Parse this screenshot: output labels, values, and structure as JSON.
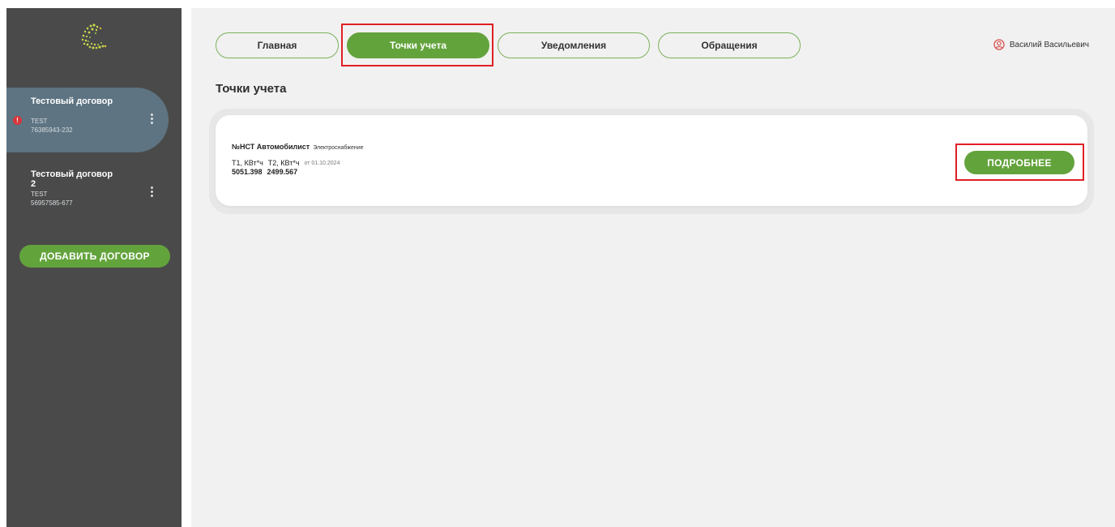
{
  "sidebar": {
    "contracts": [
      {
        "name": "Тестовый договор",
        "code": "TEST",
        "number": "76385943-232",
        "active": true,
        "has_alert": true
      },
      {
        "name": "Тестовый договор 2",
        "code": "TEST",
        "number": "56957585-677",
        "active": false,
        "has_alert": false
      }
    ],
    "add_label": "ДОБАВИТЬ ДОГОВОР",
    "alert_glyph": "!"
  },
  "nav": {
    "tabs": [
      {
        "label": "Главная",
        "active": false
      },
      {
        "label": "Точки учета",
        "active": true
      },
      {
        "label": "Уведомления",
        "active": false
      },
      {
        "label": "Обращения",
        "active": false
      }
    ]
  },
  "user": {
    "name": "Василий Васильевич",
    "icon": "user-circle-icon"
  },
  "page": {
    "title": "Точки учета"
  },
  "point": {
    "title": "№НСТ Автомобилист",
    "type": "Электроснабжение",
    "t1_label": "Т1, КВт*ч",
    "t2_label": "Т2, КВт*ч",
    "date": "от 01.10.2024",
    "t1_value": "5051.398",
    "t2_value": "2499.567",
    "details_label": "ПОДРОБНЕЕ"
  },
  "colors": {
    "accent": "#63a33c",
    "sidebar": "#4a4a4a",
    "active_contract": "#5e7482",
    "highlight": "#e01e26"
  }
}
